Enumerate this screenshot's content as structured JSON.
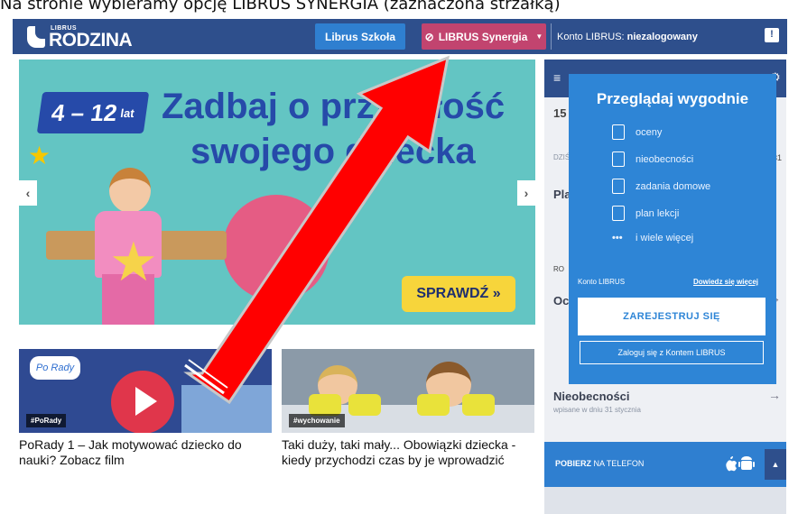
{
  "caption": "Na stronie wybieramy opcję LIBRUS SYNERGIA (zaznaczona strzałką)",
  "header": {
    "logo_small": "LIBRUS",
    "logo_big": "RODZINA",
    "btn_szkola": "Librus Szkoła",
    "btn_synergia": "LIBRUS Synergia",
    "konto_label": "Konto LIBRUS:",
    "konto_status": "niezalogowany"
  },
  "hero": {
    "age": "4 – 12",
    "age_unit": "lat",
    "line1": "Zadbaj o przyszłość",
    "line2": "swojego dziecka",
    "cta": "SPRAWDŹ »",
    "prev": "‹",
    "next": "›"
  },
  "cards": [
    {
      "badge": "Po Rady",
      "tag": "#PoRady",
      "title": "PoRady 1 – Jak motywować dziecko do nauki? Zobacz film"
    },
    {
      "tag": "#wychowanie",
      "title": "Taki duży, taki mały... Obowiązki dziecka - kiedy przychodzi czas by je wprowadzić"
    }
  ],
  "sidebar": {
    "date_num": "15",
    "label_dzis": "DZIŚ",
    "range_end": "-31",
    "row_pla": "Pla",
    "row_oc": "Oc",
    "label_ro": "RO",
    "nieobecnosci": "Nieobecności",
    "nieobecnosci_sub": "wpisane w dniu 31 stycznia"
  },
  "popup": {
    "title": "Przeglądaj wygodnie",
    "features": [
      "oceny",
      "nieobecności",
      "zadania domowe",
      "plan lekcji",
      "i wiele więcej"
    ],
    "konto_label": "Konto LIBRUS",
    "more_link": "Dowiedz się więcej",
    "register": "ZAREJESTRUJ SIĘ",
    "login": "Zaloguj się z Kontem LIBRUS"
  },
  "download": {
    "bold": "POBIERZ",
    "rest": "NA TELEFON",
    "apps": "",
    "caret": "▲"
  },
  "colors": {
    "topbar": "#2e4f8c",
    "synergia": "#c2446f",
    "szkola": "#2f7fd0",
    "popup": "#2e85d6",
    "arrow": "#ff0000"
  }
}
